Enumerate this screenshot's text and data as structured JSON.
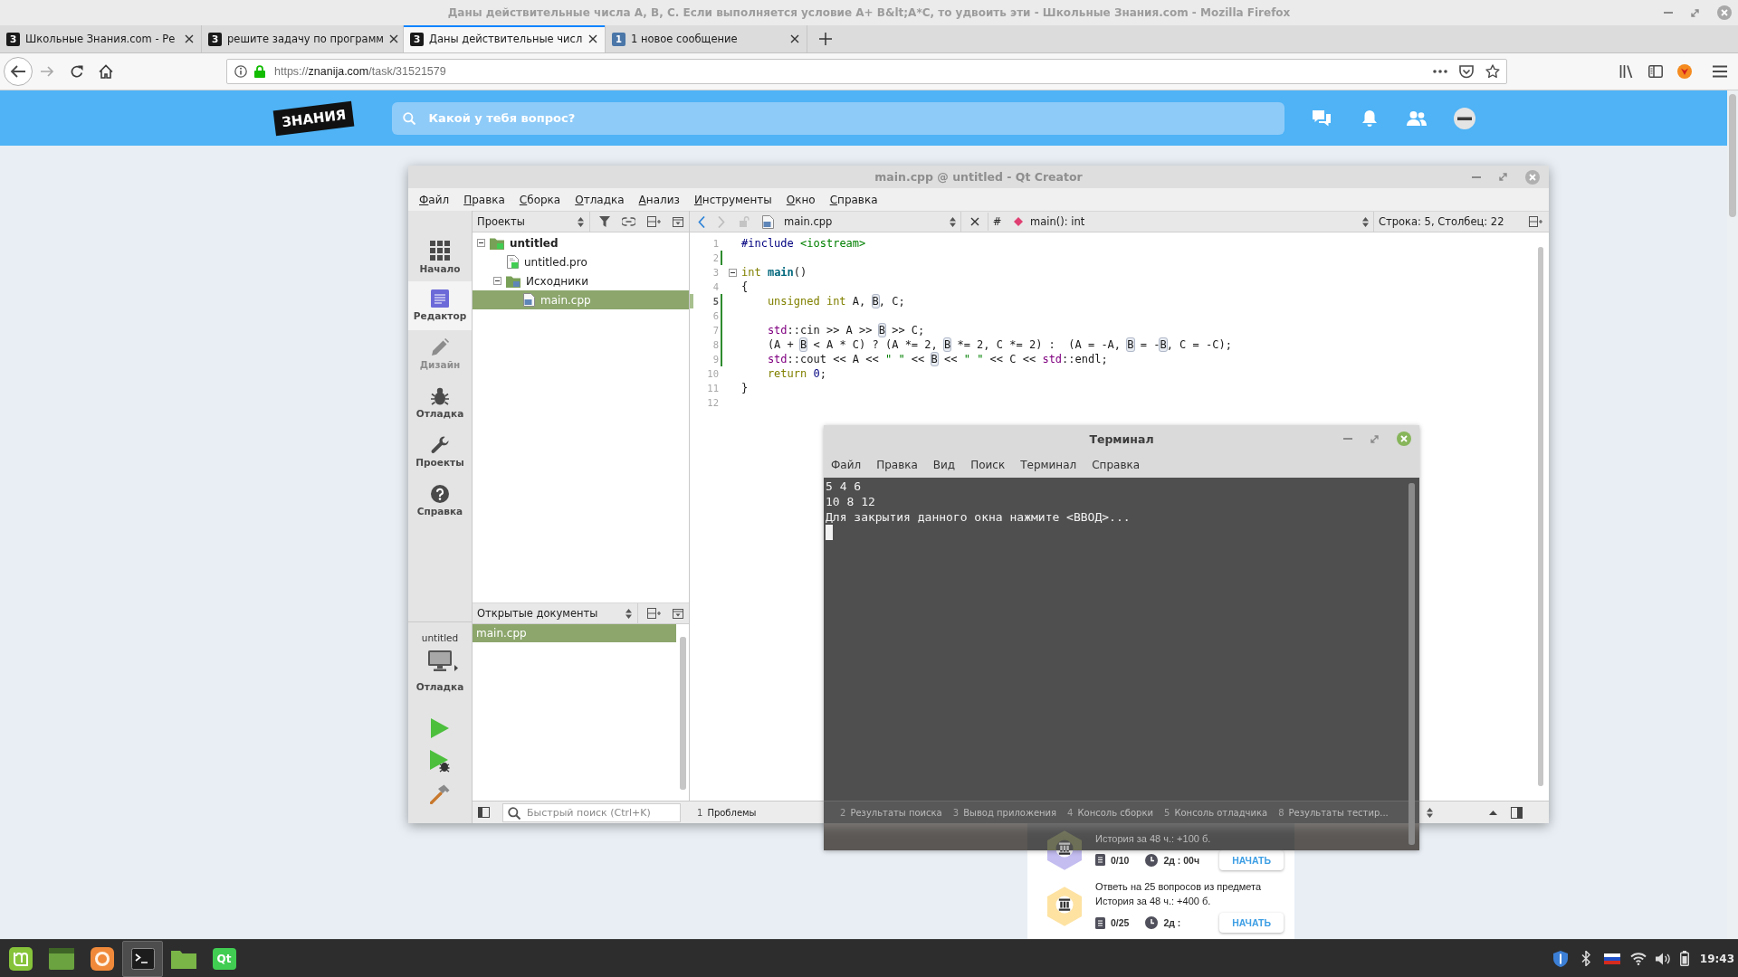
{
  "browser": {
    "title": "Даны действительные числа A, B, C. Если выполняется условие A+ B&lt;A*C, то удвоить эти - Школьные Знания.com - Mozilla Firefox",
    "tabs": [
      {
        "favicon": "З",
        "color": "#1a1a1a",
        "title": "Школьные Знания.com - Ре",
        "selected": false
      },
      {
        "favicon": "З",
        "color": "#1a1a1a",
        "title": "решите задачу по программ",
        "selected": false
      },
      {
        "favicon": "З",
        "color": "#1a1a1a",
        "title": "Даны действительные числ",
        "selected": true
      },
      {
        "favicon": "1",
        "color": "#4a76a8",
        "title": "1 новое сообщение",
        "selected": false
      }
    ],
    "url": {
      "scheme": "https://",
      "host": "znanija.com",
      "path": "/task/31521579"
    }
  },
  "page": {
    "logo": "ЗНАНИЯ",
    "search": {
      "placeholder": "Какой у тебя вопрос?"
    },
    "tasks": [
      {
        "color": "#c3bdf0",
        "lines": [
          "История за 48 ч.: +100 б."
        ],
        "count": "0/10",
        "time": "2д : 00ч",
        "button": "НАЧАТЬ"
      },
      {
        "color": "#fde2a2",
        "lines": [
          "Ответь на 25 вопросов из предмета",
          "История за 48 ч.: +400 б."
        ],
        "count": "0/25",
        "time": "2д :",
        "button": "НАЧАТЬ"
      }
    ]
  },
  "qt_creator": {
    "title": "main.cpp @ untitled - Qt Creator",
    "menu": [
      "Файл",
      "Правка",
      "Сборка",
      "Отладка",
      "Анализ",
      "Инструменты",
      "Окно",
      "Справка"
    ],
    "modes": [
      {
        "label": "Начало",
        "selected": false,
        "disabled": false
      },
      {
        "label": "Редактор",
        "selected": true,
        "disabled": false
      },
      {
        "label": "Дизайн",
        "selected": false,
        "disabled": true
      },
      {
        "label": "Отладка",
        "selected": false,
        "disabled": false
      },
      {
        "label": "Проекты",
        "selected": false,
        "disabled": false
      },
      {
        "label": "Справка",
        "selected": false,
        "disabled": false
      }
    ],
    "run_target": {
      "project": "untitled",
      "mode": "Отладка"
    },
    "projects_pane": {
      "view": "Проекты",
      "tree": [
        {
          "label": "untitled",
          "kind": "project",
          "expanded": true,
          "selected": false,
          "children": [
            {
              "label": "untitled.pro",
              "kind": "project-file",
              "selected": false
            },
            {
              "label": "Исходники",
              "kind": "folder",
              "expanded": true,
              "selected": false,
              "children": [
                {
                  "label": "main.cpp",
                  "kind": "source",
                  "selected": true
                }
              ]
            }
          ]
        }
      ]
    },
    "open_documents": {
      "view": "Открытые документы",
      "items": [
        {
          "label": "main.cpp",
          "selected": true
        }
      ]
    },
    "editor": {
      "file": "main.cpp",
      "hash": "#",
      "symbol": "main(): int",
      "position": "Строка: 5, Столбец: 22",
      "lines": [
        {
          "number": "1",
          "current": false,
          "modified": false,
          "fold": false,
          "tokens": [
            {
              "text": "#include ",
              "kind": "preprocessor"
            },
            {
              "text": "<iostream>",
              "kind": "include"
            }
          ]
        },
        {
          "number": "2",
          "current": false,
          "modified": true,
          "fold": false
        },
        {
          "number": "3",
          "current": false,
          "modified": false,
          "fold": true,
          "tokens": [
            {
              "text": "int ",
              "kind": "keyword"
            },
            {
              "text": "main",
              "kind": "function"
            },
            {
              "text": "()",
              "kind": "plain"
            }
          ]
        },
        {
          "number": "4",
          "current": false,
          "modified": false,
          "fold": false,
          "tokens": [
            {
              "text": "{",
              "kind": "plain"
            }
          ]
        },
        {
          "number": "5",
          "current": true,
          "modified": true,
          "fold": false,
          "tokens": [
            {
              "text": "    unsigned int",
              "kind": "keyword"
            },
            {
              "text": " A, ",
              "kind": "plain"
            },
            {
              "text": "B",
              "kind": "occurrence"
            },
            {
              "text": ", C;",
              "kind": "plain"
            }
          ]
        },
        {
          "number": "6",
          "current": false,
          "modified": true,
          "fold": false
        },
        {
          "number": "7",
          "current": false,
          "modified": true,
          "fold": false,
          "tokens": [
            {
              "text": "    std",
              "kind": "namespace"
            },
            {
              "text": "::cin >> A >> ",
              "kind": "plain"
            },
            {
              "text": "B",
              "kind": "occurrence"
            },
            {
              "text": " >> C;",
              "kind": "plain"
            }
          ]
        },
        {
          "number": "8",
          "current": false,
          "modified": true,
          "fold": false,
          "tokens": [
            {
              "text": "    (A + ",
              "kind": "plain"
            },
            {
              "text": "B",
              "kind": "occurrence"
            },
            {
              "text": " < A * C) ? (A *= 2, ",
              "kind": "plain"
            },
            {
              "text": "B",
              "kind": "occurrence"
            },
            {
              "text": " *= 2, C *= 2) :  (A = -A, ",
              "kind": "plain"
            },
            {
              "text": "B",
              "kind": "occurrence"
            },
            {
              "text": " = -",
              "kind": "plain"
            },
            {
              "text": "B",
              "kind": "occurrence"
            },
            {
              "text": ", C = -C);",
              "kind": "plain"
            }
          ]
        },
        {
          "number": "9",
          "current": false,
          "modified": true,
          "fold": false,
          "tokens": [
            {
              "text": "    std",
              "kind": "namespace"
            },
            {
              "text": "::cout << A << ",
              "kind": "plain"
            },
            {
              "text": "\" \"",
              "kind": "string"
            },
            {
              "text": " << ",
              "kind": "plain"
            },
            {
              "text": "B",
              "kind": "occurrence"
            },
            {
              "text": " << ",
              "kind": "plain"
            },
            {
              "text": "\" \"",
              "kind": "string"
            },
            {
              "text": " << C << ",
              "kind": "plain"
            },
            {
              "text": "std",
              "kind": "namespace"
            },
            {
              "text": "::endl;",
              "kind": "plain"
            }
          ]
        },
        {
          "number": "10",
          "current": false,
          "modified": false,
          "fold": false,
          "tokens": [
            {
              "text": "    return ",
              "kind": "keyword"
            },
            {
              "text": "0",
              "kind": "number"
            },
            {
              "text": ";",
              "kind": "plain"
            }
          ]
        },
        {
          "number": "11",
          "current": false,
          "modified": false,
          "fold": false,
          "tokens": [
            {
              "text": "}",
              "kind": "plain"
            }
          ]
        },
        {
          "number": "12",
          "current": false,
          "modified": false,
          "fold": false
        }
      ]
    },
    "locator": {
      "placeholder": "Быстрый поиск (Ctrl+K)"
    },
    "output_tabs": [
      {
        "number": "1",
        "label": "Проблемы"
      },
      {
        "number": "2",
        "label": "Результаты поиска"
      },
      {
        "number": "3",
        "label": "Вывод приложения"
      },
      {
        "number": "4",
        "label": "Консоль сборки"
      },
      {
        "number": "5",
        "label": "Консоль отладчика"
      },
      {
        "number": "8",
        "label": "Результаты тестир..."
      }
    ]
  },
  "terminal": {
    "title": "Терминал",
    "menu": [
      "Файл",
      "Правка",
      "Вид",
      "Поиск",
      "Терминал",
      "Справка"
    ],
    "output": [
      "5 4 6",
      "10 8 12",
      "Для закрытия данного окна нажмите <ВВОД>..."
    ]
  },
  "taskbar": {
    "apps": [
      {
        "active": false
      },
      {
        "active": false
      },
      {
        "active": false
      },
      {
        "active": true
      },
      {
        "active": false
      },
      {
        "active": false,
        "label": "Qt"
      }
    ],
    "clock": "19:43"
  }
}
